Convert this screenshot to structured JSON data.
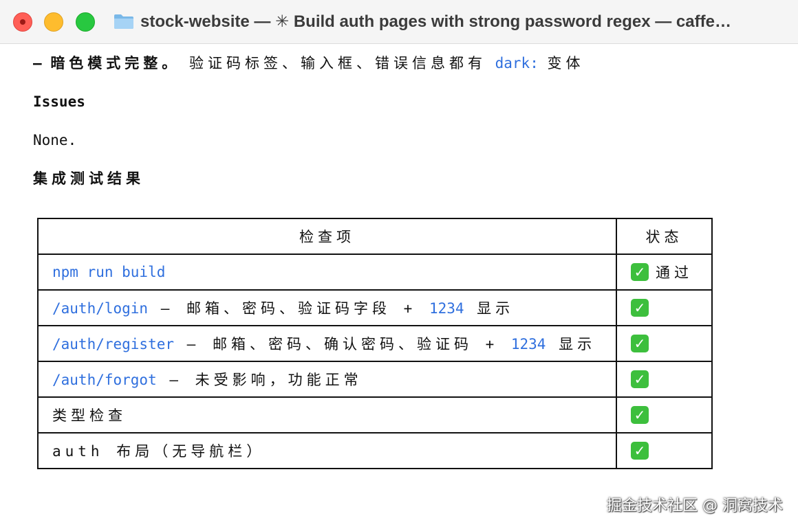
{
  "window": {
    "title": "stock-website — ✳ Build auth pages with strong password regex — caffe…",
    "folder_icon": "folder-icon"
  },
  "content": {
    "line1": {
      "bullet": "–",
      "bold": "暗色模式完整。",
      "text": "验证码标签、输入框、错误信息都有",
      "code": "dark:",
      "tail": "变体"
    },
    "issues_heading": "Issues",
    "issues_body": "None.",
    "results_heading": "集成测试结果",
    "table": {
      "headers": [
        "检查项",
        "状态"
      ],
      "rows": [
        {
          "code": "npm run build",
          "text": "",
          "num": "",
          "tail": "",
          "status_icon": "check-mark-icon",
          "status_text": "通过"
        },
        {
          "code": "/auth/login",
          "text": " — 邮箱、密码、验证码字段 + ",
          "num": "1234",
          "tail": " 显示",
          "status_icon": "check-mark-icon",
          "status_text": ""
        },
        {
          "code": "/auth/register",
          "text": " — 邮箱、密码、确认密码、验证码 + ",
          "num": "1234",
          "tail": " 显示",
          "status_icon": "check-mark-icon",
          "status_text": ""
        },
        {
          "code": "/auth/forgot",
          "text": " — 未受影响，功能正常",
          "num": "",
          "tail": "",
          "status_icon": "check-mark-icon",
          "status_text": ""
        },
        {
          "code": "",
          "text": "类型检查",
          "num": "",
          "tail": "",
          "status_icon": "check-mark-icon",
          "status_text": ""
        },
        {
          "code": "",
          "text": "auth 布局（无导航栏）",
          "num": "",
          "tail": "",
          "status_icon": "check-mark-icon",
          "status_text": ""
        }
      ]
    }
  },
  "watermark": "掘金技术社区 @ 洞窝技术",
  "colors": {
    "code": "#2f6fde",
    "check": "#3dbf3d",
    "titlebar": "#f5f5f5"
  }
}
